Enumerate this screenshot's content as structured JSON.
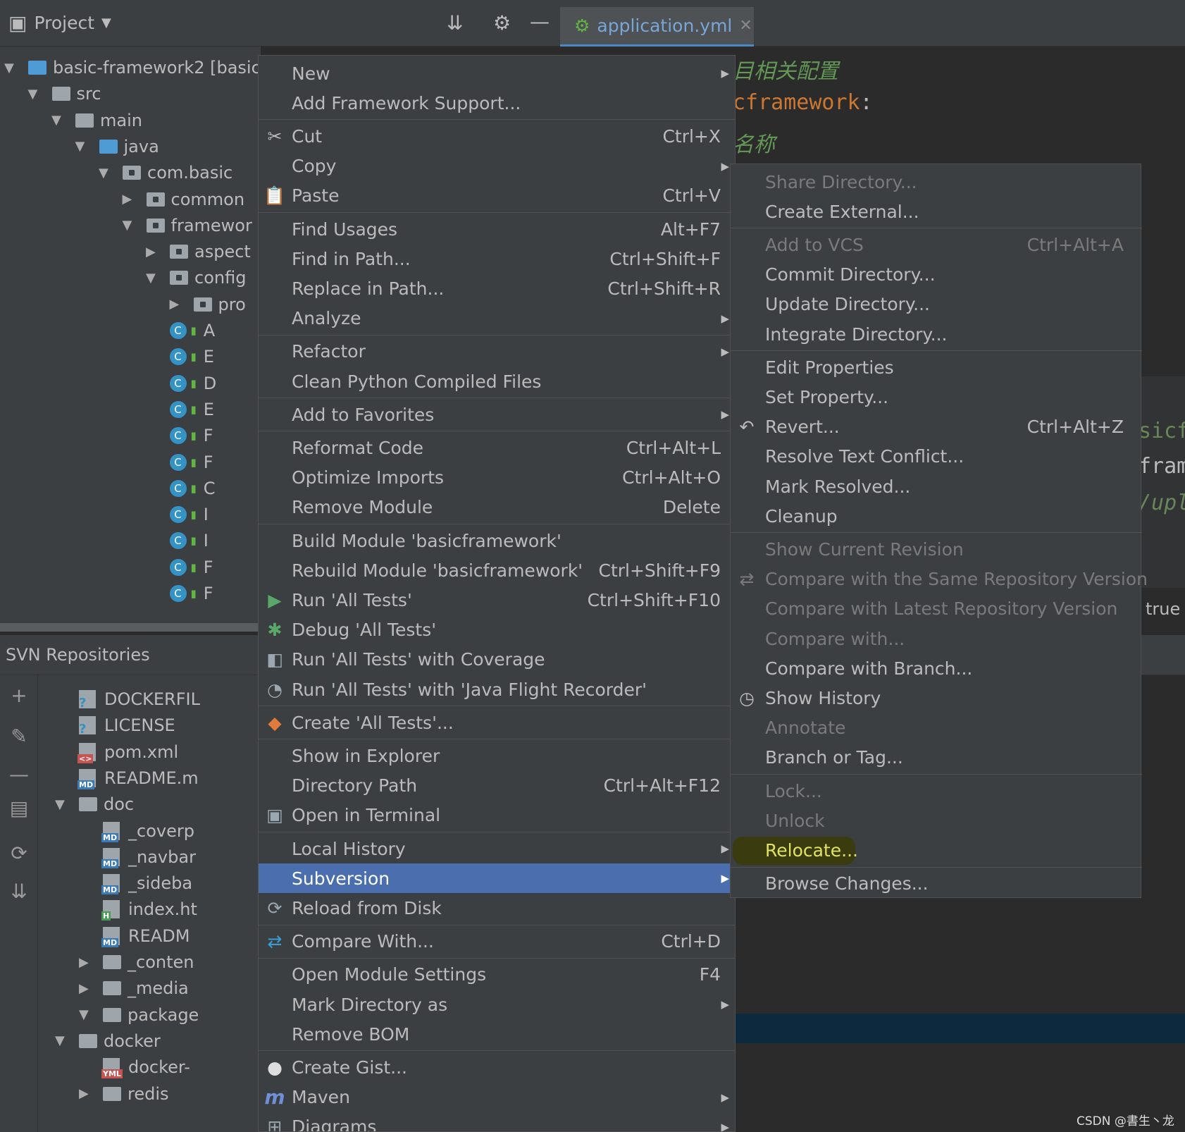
{
  "toolbar": {
    "project_label": "Project",
    "editor_tab": "application.yml"
  },
  "project_tree": [
    {
      "depth": 0,
      "type": "module",
      "label": "basic-framework2 [basicf"
    },
    {
      "depth": 1,
      "type": "folder",
      "label": "src"
    },
    {
      "depth": 2,
      "type": "folder",
      "label": "main"
    },
    {
      "depth": 3,
      "type": "folder-blue",
      "label": "java"
    },
    {
      "depth": 4,
      "type": "package",
      "label": "com.basic"
    },
    {
      "depth": 5,
      "type": "package",
      "label": "common",
      "collapsed": true
    },
    {
      "depth": 5,
      "type": "package",
      "label": "framewor"
    },
    {
      "depth": 6,
      "type": "package",
      "label": "aspect",
      "collapsed": true
    },
    {
      "depth": 6,
      "type": "package",
      "label": "config"
    },
    {
      "depth": 7,
      "type": "package",
      "label": "pro",
      "collapsed": true
    },
    {
      "depth": 7,
      "type": "class",
      "label": "A"
    },
    {
      "depth": 7,
      "type": "class",
      "label": "E"
    },
    {
      "depth": 7,
      "type": "class",
      "label": "D"
    },
    {
      "depth": 7,
      "type": "class",
      "label": "E"
    },
    {
      "depth": 7,
      "type": "class",
      "label": "F"
    },
    {
      "depth": 7,
      "type": "class",
      "label": "F"
    },
    {
      "depth": 7,
      "type": "class",
      "label": "C"
    },
    {
      "depth": 7,
      "type": "class",
      "label": "I"
    },
    {
      "depth": 7,
      "type": "class",
      "label": "I"
    },
    {
      "depth": 7,
      "type": "class",
      "label": "F"
    },
    {
      "depth": 7,
      "type": "class",
      "label": "F"
    }
  ],
  "svn": {
    "title": "SVN Repositories",
    "tree": [
      {
        "depth": 2,
        "type": "file",
        "label": "DOCKERFIL",
        "badge": "?"
      },
      {
        "depth": 2,
        "type": "file",
        "label": "LICENSE",
        "badge": "?"
      },
      {
        "depth": 2,
        "type": "file",
        "label": "pom.xml",
        "badge": "<>"
      },
      {
        "depth": 2,
        "type": "file",
        "label": "README.m",
        "badge": "MD"
      },
      {
        "depth": 1,
        "type": "folder",
        "label": "doc"
      },
      {
        "depth": 3,
        "type": "file",
        "label": "_coverp",
        "badge": "MD"
      },
      {
        "depth": 3,
        "type": "file",
        "label": "_navbar",
        "badge": "MD"
      },
      {
        "depth": 3,
        "type": "file",
        "label": "_sideba",
        "badge": "MD"
      },
      {
        "depth": 3,
        "type": "file",
        "label": "index.ht",
        "badge": "H"
      },
      {
        "depth": 3,
        "type": "file",
        "label": "READM",
        "badge": "MD"
      },
      {
        "depth": 2,
        "type": "folder",
        "label": "_conten",
        "collapsed": true
      },
      {
        "depth": 2,
        "type": "folder",
        "label": "_media",
        "collapsed": true
      },
      {
        "depth": 2,
        "type": "folder",
        "label": "package",
        "selected": true
      },
      {
        "depth": 1,
        "type": "folder",
        "label": "docker"
      },
      {
        "depth": 3,
        "type": "file",
        "label": "docker-",
        "badge": "YML"
      },
      {
        "depth": 2,
        "type": "folder",
        "label": "redis",
        "collapsed": true
      }
    ]
  },
  "editor": {
    "line1": "目相关配置",
    "line2_key": "cframework",
    "line2_colon": ":",
    "line3": "名称",
    "frag1": "sicf",
    "frag2": "fram",
    "frag3": "/upl",
    "frag4": "true"
  },
  "context_menu": [
    {
      "label": "New",
      "submenu": true
    },
    {
      "label": "Add Framework Support..."
    },
    {
      "sep": true
    },
    {
      "label": "Cut",
      "shortcut": "Ctrl+X",
      "icon": "✂",
      "icon_name": "cut-icon"
    },
    {
      "label": "Copy",
      "submenu": true
    },
    {
      "label": "Paste",
      "shortcut": "Ctrl+V",
      "icon": "📋",
      "icon_name": "paste-icon"
    },
    {
      "sep": true
    },
    {
      "label": "Find Usages",
      "shortcut": "Alt+F7"
    },
    {
      "label": "Find in Path...",
      "shortcut": "Ctrl+Shift+F"
    },
    {
      "label": "Replace in Path...",
      "shortcut": "Ctrl+Shift+R"
    },
    {
      "label": "Analyze",
      "submenu": true
    },
    {
      "sep": true
    },
    {
      "label": "Refactor",
      "submenu": true
    },
    {
      "label": "Clean Python Compiled Files"
    },
    {
      "sep": true
    },
    {
      "label": "Add to Favorites",
      "submenu": true
    },
    {
      "sep": true
    },
    {
      "label": "Reformat Code",
      "shortcut": "Ctrl+Alt+L"
    },
    {
      "label": "Optimize Imports",
      "shortcut": "Ctrl+Alt+O"
    },
    {
      "label": "Remove Module",
      "shortcut": "Delete"
    },
    {
      "sep": true
    },
    {
      "label": "Build Module 'basicframework'"
    },
    {
      "label": "Rebuild Module 'basicframework'",
      "shortcut": "Ctrl+Shift+F9"
    },
    {
      "label": "Run 'All Tests'",
      "shortcut": "Ctrl+Shift+F10",
      "icon": "▶",
      "icon_name": "run-icon",
      "icon_color": "#59a869"
    },
    {
      "label": "Debug 'All Tests'",
      "icon": "✱",
      "icon_name": "debug-icon",
      "icon_color": "#59a869"
    },
    {
      "label": "Run 'All Tests' with Coverage",
      "icon": "◧",
      "icon_name": "coverage-icon",
      "icon_color": "#9aa7b0"
    },
    {
      "label": "Run 'All Tests' with 'Java Flight Recorder'",
      "icon": "◔",
      "icon_name": "flight-recorder-icon",
      "icon_color": "#9aa7b0"
    },
    {
      "sep": true
    },
    {
      "label": "Create 'All Tests'...",
      "icon": "◆",
      "icon_name": "create-test-icon",
      "icon_color": "#e07b39"
    },
    {
      "sep": true
    },
    {
      "label": "Show in Explorer"
    },
    {
      "label": "Directory Path",
      "shortcut": "Ctrl+Alt+F12"
    },
    {
      "label": "Open in Terminal",
      "icon": "▣",
      "icon_name": "terminal-icon",
      "icon_color": "#9aa7b0"
    },
    {
      "sep": true
    },
    {
      "label": "Local History",
      "submenu": true
    },
    {
      "label": "Subversion",
      "submenu": true,
      "selected": true
    },
    {
      "label": "Reload from Disk",
      "icon": "⟳",
      "icon_name": "reload-icon",
      "icon_color": "#9aa7b0"
    },
    {
      "sep": true
    },
    {
      "label": "Compare With...",
      "shortcut": "Ctrl+D",
      "icon": "⇄",
      "icon_name": "compare-icon",
      "icon_color": "#389fd6"
    },
    {
      "sep": true
    },
    {
      "label": "Open Module Settings",
      "shortcut": "F4"
    },
    {
      "label": "Mark Directory as",
      "submenu": true
    },
    {
      "label": "Remove BOM"
    },
    {
      "sep": true
    },
    {
      "label": "Create Gist...",
      "icon": "●",
      "icon_name": "github-icon",
      "icon_color": "#dddddd"
    },
    {
      "label": "Maven",
      "submenu": true,
      "icon": "m",
      "icon_name": "maven-icon",
      "icon_color": "#6f8fd8"
    },
    {
      "label": "Diagrams",
      "submenu": true,
      "icon": "⊞",
      "icon_name": "diagrams-icon",
      "icon_color": "#9aa7b0"
    }
  ],
  "subversion_menu": [
    {
      "label": "Share Directory...",
      "disabled": true
    },
    {
      "label": "Create External..."
    },
    {
      "sep": true
    },
    {
      "label": "Add to VCS",
      "shortcut": "Ctrl+Alt+A",
      "disabled": true
    },
    {
      "label": "Commit Directory..."
    },
    {
      "label": "Update Directory..."
    },
    {
      "label": "Integrate Directory..."
    },
    {
      "sep": true
    },
    {
      "label": "Edit Properties"
    },
    {
      "label": "Set Property..."
    },
    {
      "label": "Revert...",
      "shortcut": "Ctrl+Alt+Z",
      "icon": "↶",
      "icon_name": "revert-icon"
    },
    {
      "label": "Resolve Text Conflict..."
    },
    {
      "label": "Mark Resolved..."
    },
    {
      "label": "Cleanup"
    },
    {
      "sep": true
    },
    {
      "label": "Show Current Revision",
      "disabled": true
    },
    {
      "label": "Compare with the Same Repository Version",
      "disabled": true,
      "icon": "⇄",
      "icon_name": "compare-same-icon"
    },
    {
      "label": "Compare with Latest Repository Version",
      "disabled": true
    },
    {
      "label": "Compare with...",
      "disabled": true
    },
    {
      "label": "Compare with Branch..."
    },
    {
      "label": "Show History",
      "icon": "◷",
      "icon_name": "history-icon"
    },
    {
      "label": "Annotate",
      "disabled": true
    },
    {
      "label": "Branch or Tag..."
    },
    {
      "sep": true
    },
    {
      "label": "Lock...",
      "disabled": true
    },
    {
      "label": "Unlock",
      "disabled": true
    },
    {
      "label": "Relocate...",
      "highlighted": true
    },
    {
      "sep": true
    },
    {
      "label": "Browse Changes..."
    }
  ],
  "watermark": "CSDN @書生丶龙"
}
